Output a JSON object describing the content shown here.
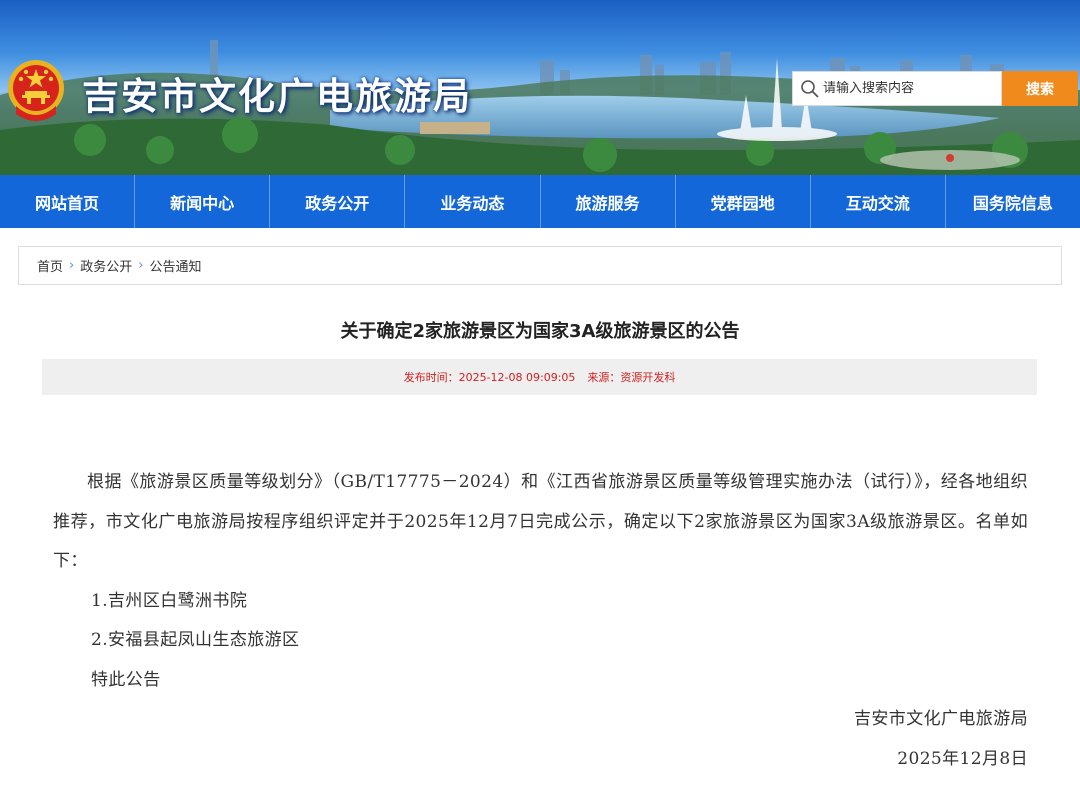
{
  "site": {
    "title": "吉安市文化广电旅游局"
  },
  "search": {
    "placeholder": "请输入搜索内容",
    "button_label": "搜索"
  },
  "nav": {
    "items": [
      "网站首页",
      "新闻中心",
      "政务公开",
      "业务动态",
      "旅游服务",
      "党群园地",
      "互动交流",
      "国务院信息"
    ]
  },
  "breadcrumb": {
    "items": [
      "首页",
      "政务公开",
      "公告通知"
    ]
  },
  "article": {
    "title": "关于确定2家旅游景区为国家3A级旅游景区的公告",
    "meta": {
      "time_label": "发布时间：",
      "time_value": "2025-12-08 09:09:05",
      "source_label": "来源：",
      "source_value": "资源开发科"
    },
    "paragraph": "根据《旅游景区质量等级划分》（GB/T17775－2024）和《江西省旅游景区质量等级管理实施办法（试行）》，经各地组织推荐，市文化广电旅游局按程序组织评定并于2025年12月7日完成公示，确定以下2家旅游景区为国家3A级旅游景区。名单如下：",
    "list": [
      "1.吉州区白鹭洲书院",
      "2.安福县起凤山生态旅游区"
    ],
    "closing": "特此公告",
    "signature": "吉安市文化广电旅游局",
    "date": "2025年12月8日"
  },
  "colors": {
    "nav_bg": "#1367d8",
    "search_button": "#f08a1c",
    "meta_text": "#d31f1f",
    "meta_bg": "#efefef"
  }
}
